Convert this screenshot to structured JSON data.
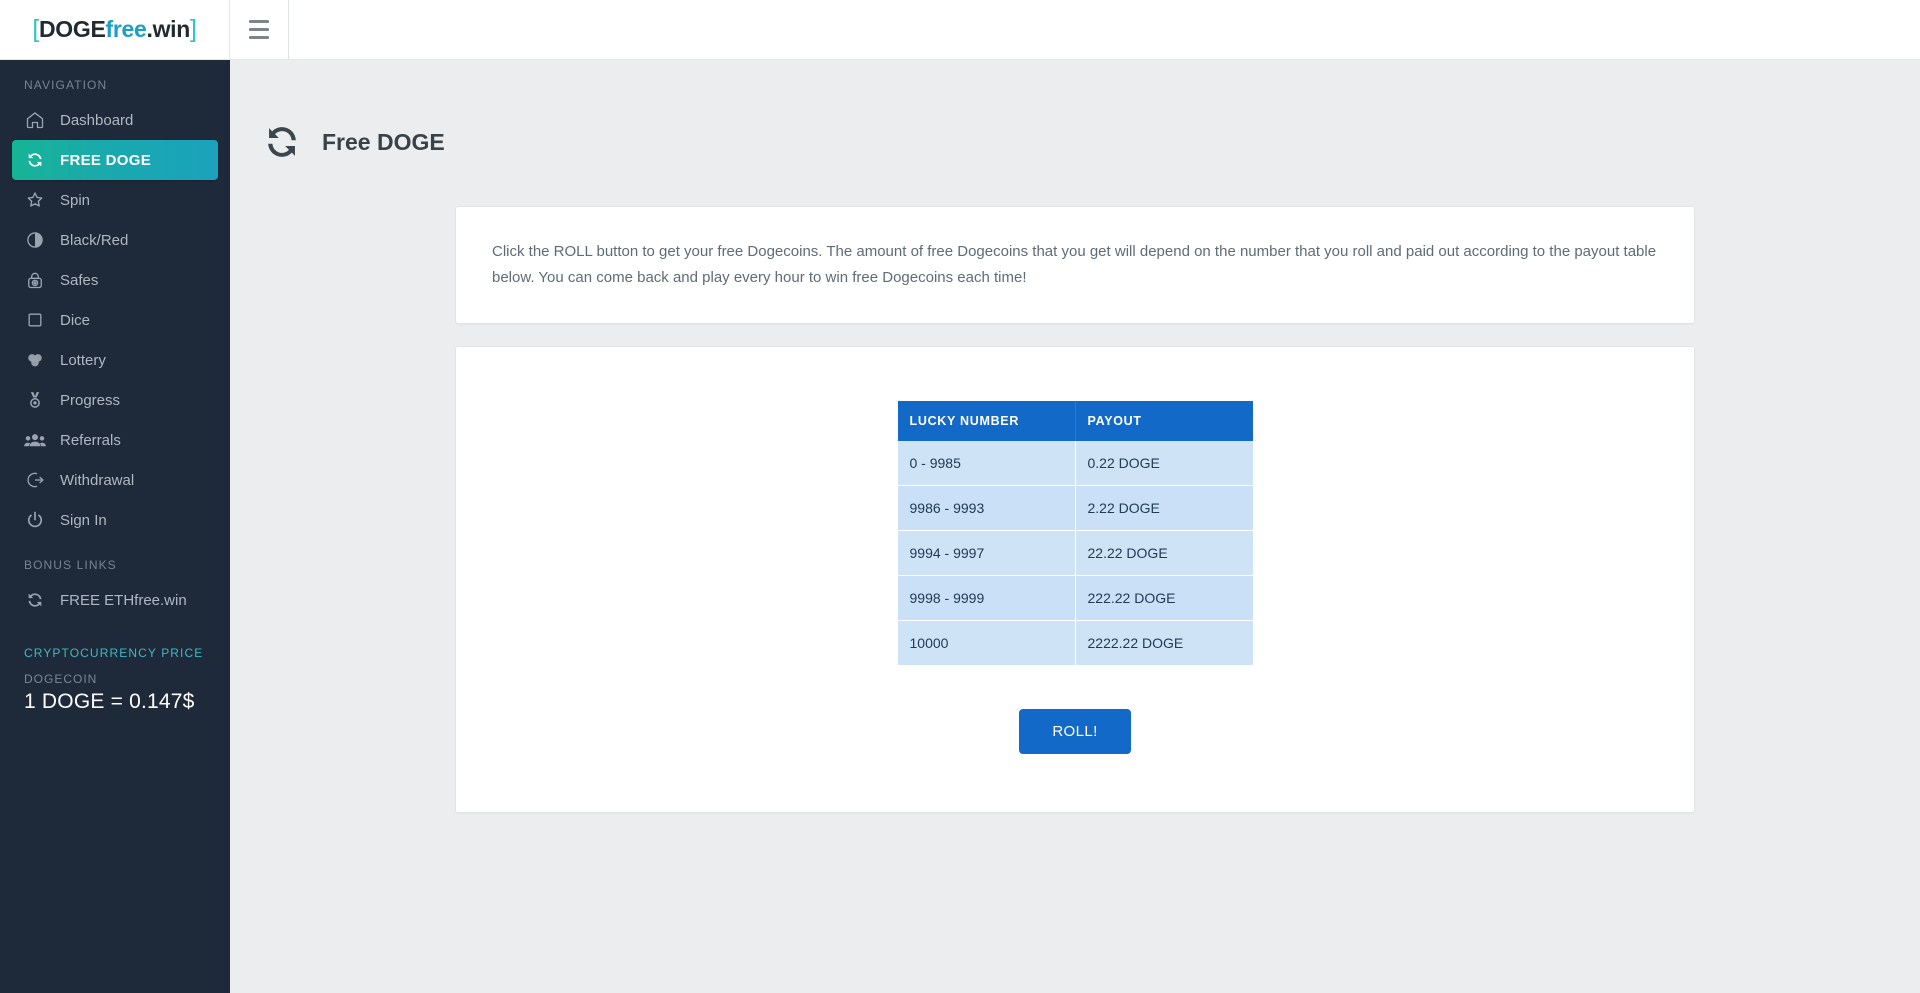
{
  "brand": {
    "bracket_left": "[",
    "part1": "DOGE",
    "part2": "free",
    "part3": ".win",
    "bracket_right": "]"
  },
  "topbar": {
    "menu_toggle_label": "menu-toggle"
  },
  "sidebar": {
    "nav_heading": "NAVIGATION",
    "items": [
      {
        "label": "Dashboard",
        "icon": "home-icon",
        "active": false
      },
      {
        "label": "FREE DOGE",
        "icon": "refresh-icon",
        "active": true
      },
      {
        "label": "Spin",
        "icon": "star-icon",
        "active": false
      },
      {
        "label": "Black/Red",
        "icon": "half-circle-icon",
        "active": false
      },
      {
        "label": "Safes",
        "icon": "lock-icon",
        "active": false
      },
      {
        "label": "Dice",
        "icon": "square-icon",
        "active": false
      },
      {
        "label": "Lottery",
        "icon": "balls-icon",
        "active": false
      },
      {
        "label": "Progress",
        "icon": "medal-icon",
        "active": false
      },
      {
        "label": "Referrals",
        "icon": "users-icon",
        "active": false
      },
      {
        "label": "Withdrawal",
        "icon": "sign-out-icon",
        "active": false
      },
      {
        "label": "Sign In",
        "icon": "power-icon",
        "active": false
      }
    ],
    "bonus_heading": "BONUS LINKS",
    "bonus_items": [
      {
        "label": "FREE ETHfree.win",
        "icon": "refresh-icon"
      }
    ],
    "crypto_heading": "CRYPTOCURRENCY PRICE",
    "price": {
      "coin_label": "DOGECOIN",
      "value": "1 DOGE = 0.147$"
    }
  },
  "page": {
    "title": "Free DOGE",
    "title_icon": "refresh-icon",
    "info_text": "Click the ROLL button to get your free Dogecoins. The amount of free Dogecoins that you get will depend on the number that you roll and paid out according to the payout table below. You can come back and play every hour to win free Dogecoins each time!"
  },
  "payout_table": {
    "columns": [
      "LUCKY NUMBER",
      "PAYOUT"
    ],
    "rows": [
      [
        "0 - 9985",
        "0.22 DOGE"
      ],
      [
        "9986 - 9993",
        "2.22 DOGE"
      ],
      [
        "9994 - 9997",
        "22.22 DOGE"
      ],
      [
        "9998 - 9999",
        "222.22 DOGE"
      ],
      [
        "10000",
        "2222.22 DOGE"
      ]
    ]
  },
  "roll_button": {
    "label": "ROLL!"
  },
  "colors": {
    "sidebar_bg": "#1e2a3a",
    "active_gradient_start": "#16b496",
    "active_gradient_end": "#1ba2bd",
    "table_header": "#1269c7",
    "table_row": "#cfe3f7",
    "button": "#1269c7",
    "crypto_heading": "#3fb8c4",
    "page_bg": "#ebedef"
  }
}
